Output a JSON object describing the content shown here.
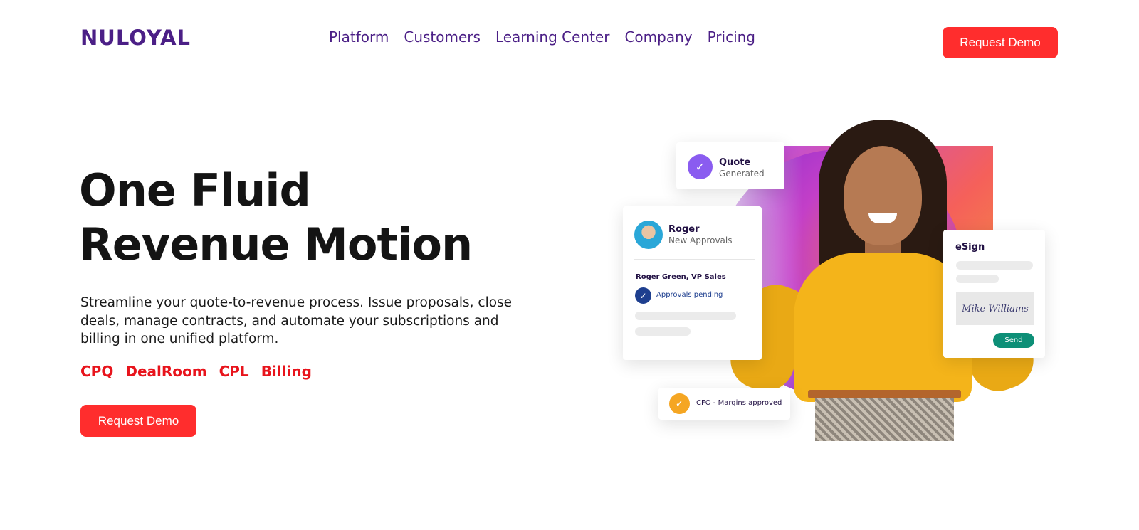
{
  "header": {
    "logo": "NULOYAL",
    "nav": [
      "Platform",
      "Customers",
      "Learning Center",
      "Company",
      "Pricing"
    ],
    "cta": "Request Demo"
  },
  "hero": {
    "title_line1": "One Fluid",
    "title_line2": "Revenue Motion",
    "subtitle": "Streamline your quote-to-revenue process. Issue proposals, close deals, manage contracts, and automate your subscriptions and billing in one unified platform.",
    "products": [
      "CPQ",
      "DealRoom",
      "CPL",
      "Billing"
    ],
    "cta": "Request Demo"
  },
  "illustration": {
    "quote_card": {
      "title": "Quote",
      "subtitle": "Generated",
      "icon": "check-icon"
    },
    "roger_card": {
      "name": "Roger",
      "subtitle": "New Approvals",
      "approver": "Roger Green, VP Sales",
      "status": "Approvals pending",
      "icon": "check-icon"
    },
    "esign_card": {
      "title": "eSign",
      "signature": "Mike Williams",
      "send": "Send"
    },
    "cfo_card": {
      "text": "CFO - Margins approved",
      "icon": "check-icon"
    }
  },
  "colors": {
    "brand_purple": "#4b1f86",
    "cta_red": "#ff2d2d",
    "product_red": "#e8141c",
    "send_green": "#0d8f77"
  }
}
